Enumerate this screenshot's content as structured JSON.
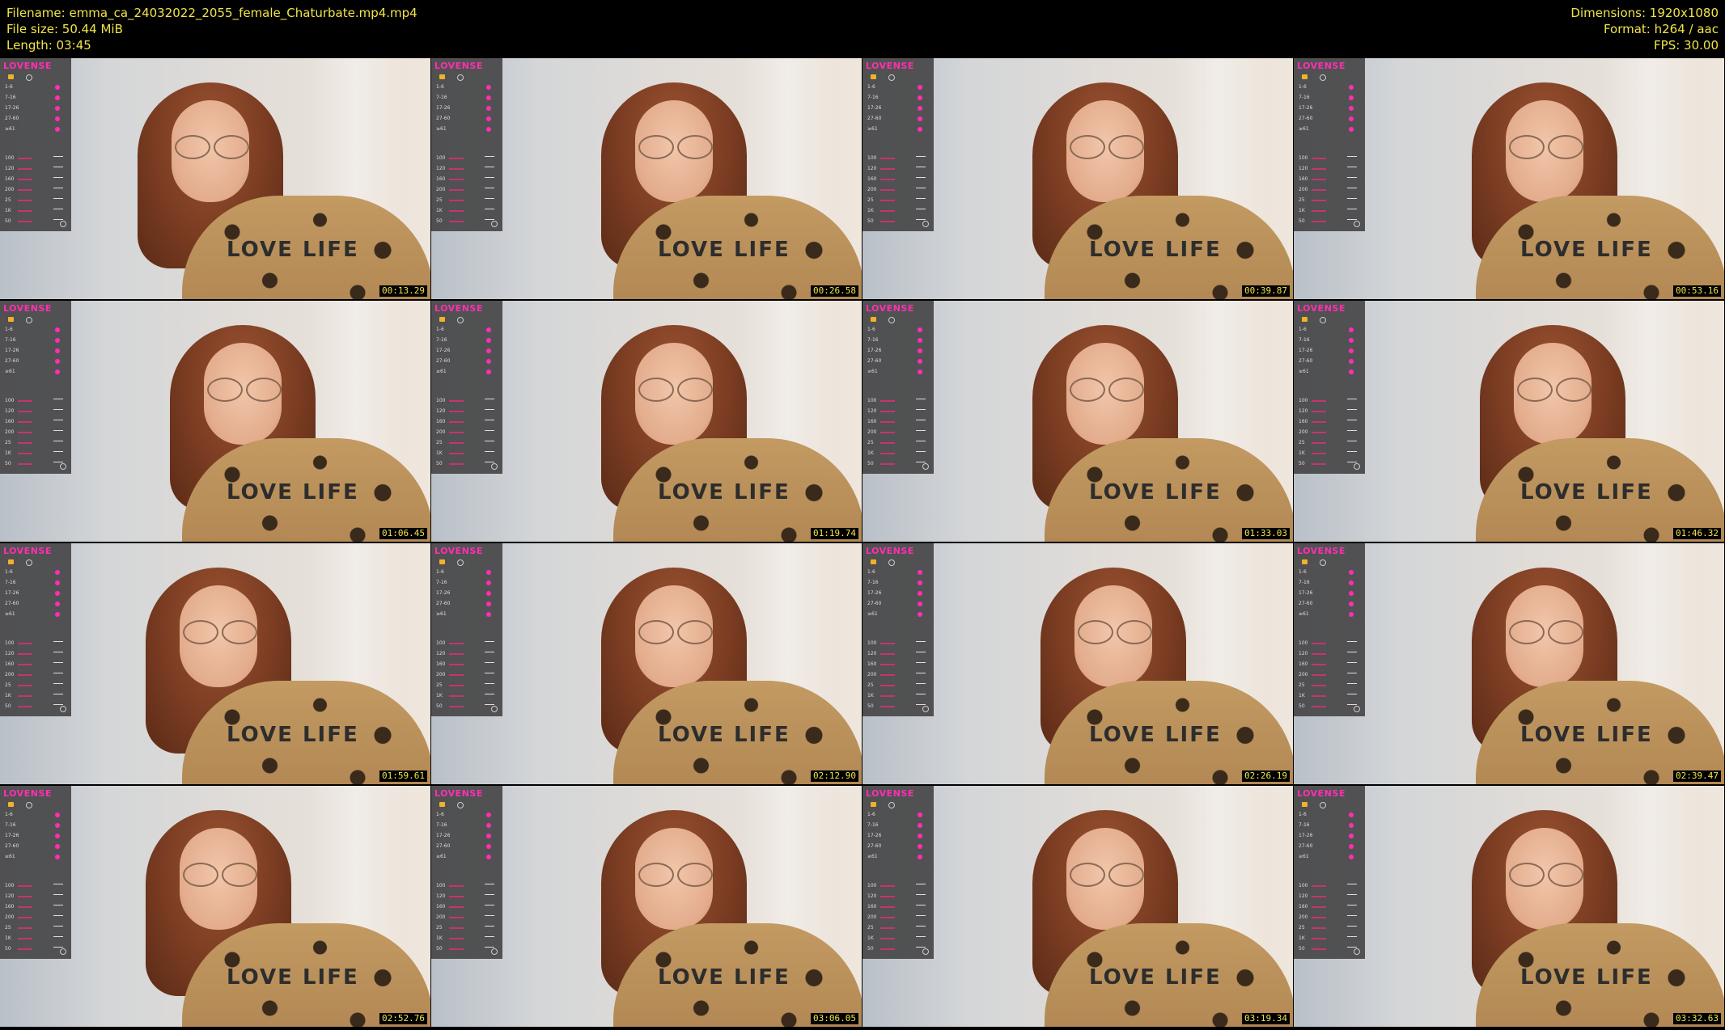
{
  "header": {
    "filename": "Filename: emma_ca_24032022_2055_female_Chaturbate.mp4.mp4",
    "file_size": "File size: 50.44 MiB",
    "length": "Length: 03:45",
    "dimensions": "Dimensions: 1920x1080",
    "format": "Format: h264 / aac",
    "fps": "FPS: 30.00"
  },
  "overlay": {
    "logo": "LOVENSE",
    "levels": [
      "1-6",
      "7-16",
      "17-26",
      "27-60",
      "≥61"
    ],
    "patterns": [
      "100",
      "120",
      "160",
      "200",
      "25",
      "1K",
      "50"
    ]
  },
  "shirt_text": "LOVE LIFE",
  "frames": [
    {
      "timestamp": "00:13.29"
    },
    {
      "timestamp": "00:26.58"
    },
    {
      "timestamp": "00:39.87"
    },
    {
      "timestamp": "00:53.16"
    },
    {
      "timestamp": "01:06.45"
    },
    {
      "timestamp": "01:19.74"
    },
    {
      "timestamp": "01:33.03"
    },
    {
      "timestamp": "01:46.32"
    },
    {
      "timestamp": "01:59.61"
    },
    {
      "timestamp": "02:12.90"
    },
    {
      "timestamp": "02:26.19"
    },
    {
      "timestamp": "02:39.47"
    },
    {
      "timestamp": "02:52.76"
    },
    {
      "timestamp": "03:06.05"
    },
    {
      "timestamp": "03:19.34"
    },
    {
      "timestamp": "03:32.63"
    }
  ]
}
